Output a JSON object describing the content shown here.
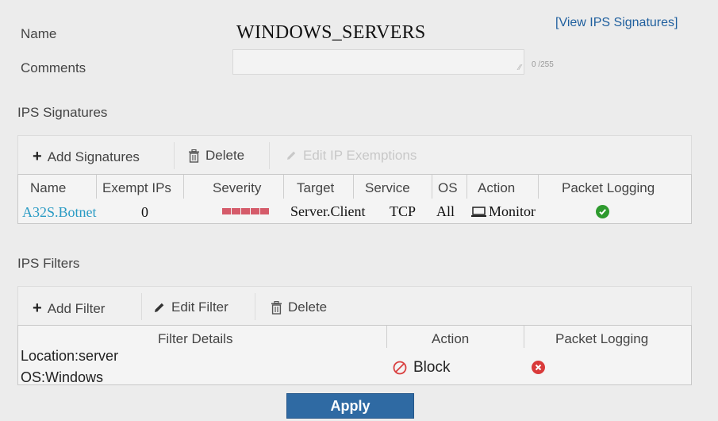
{
  "form": {
    "name_label": "Name",
    "name_value": "WINDOWS_SERVERS",
    "comments_label": "Comments",
    "comments_value": "",
    "char_count": "0 /255",
    "view_link": "[View IPS Signatures]"
  },
  "signatures": {
    "section_title": "IPS Signatures",
    "toolbar": {
      "add_label": "Add Signatures",
      "delete_label": "Delete",
      "edit_ip_label": "Edit IP Exemptions"
    },
    "columns": [
      "Name",
      "Exempt IPs",
      "Severity",
      "Target",
      "Service",
      "OS",
      "Action",
      "Packet Logging"
    ],
    "rows": [
      {
        "name": "A32S.Botnet",
        "exempt_ips": "0",
        "severity_level": 5,
        "target": "Server.Client",
        "service": "TCP",
        "os": "All",
        "action": "Monitor",
        "packet_logging": "enabled"
      }
    ]
  },
  "filters": {
    "section_title": "IPS Filters",
    "toolbar": {
      "add_label": "Add Filter",
      "edit_label": "Edit Filter",
      "delete_label": "Delete"
    },
    "columns": [
      "Filter Details",
      "Action",
      "Packet Logging"
    ],
    "rows": [
      {
        "detail_line_1": "Location:server",
        "detail_line_2": "OS:Windows",
        "action": "Block",
        "packet_logging": "disabled"
      }
    ]
  },
  "apply_label": "Apply",
  "colors": {
    "link": "#2a9bc4",
    "apply_bg": "#2f6aa3",
    "severity": "#d55b6a",
    "enabled": "#2e9a2e",
    "disabled": "#d93a3a"
  }
}
